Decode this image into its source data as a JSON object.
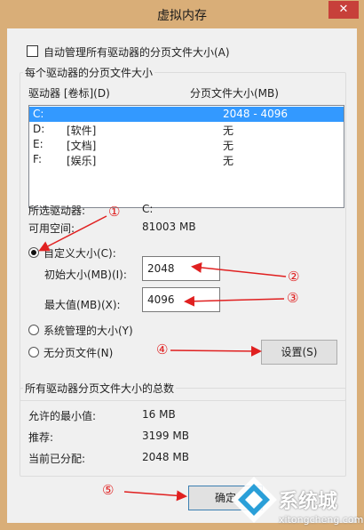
{
  "window": {
    "title": "虚拟内存",
    "close_glyph": "✕"
  },
  "auto_manage": {
    "label": "自动管理所有驱动器的分页文件大小(A)",
    "checked": false
  },
  "paging_group": {
    "title": "每个驱动器的分页文件大小",
    "col_drive": "驱动器 [卷标](D)",
    "col_size": "分页文件大小(MB)",
    "drives": [
      {
        "drive": "C:",
        "label": "",
        "size": "2048 - 4096",
        "selected": true
      },
      {
        "drive": "D:",
        "label": "[软件]",
        "size": "无",
        "selected": false
      },
      {
        "drive": "E:",
        "label": "[文档]",
        "size": "无",
        "selected": false
      },
      {
        "drive": "F:",
        "label": "[娱乐]",
        "size": "无",
        "selected": false
      }
    ],
    "selected_drive_label": "所选驱动器:",
    "selected_drive_value": "C:",
    "free_space_label": "可用空间:",
    "free_space_value": "81003 MB",
    "custom_size": "自定义大小(C):",
    "initial_size_label": "初始大小(MB)(I):",
    "initial_size_value": "2048",
    "max_size_label": "最大值(MB)(X):",
    "max_size_value": "4096",
    "system_managed": "系统管理的大小(Y)",
    "no_paging": "无分页文件(N)",
    "set_button": "设置(S)"
  },
  "totals_group": {
    "title": "所有驱动器分页文件大小的总数",
    "min_label": "允许的最小值:",
    "min_value": "16 MB",
    "recommended_label": "推荐:",
    "recommended_value": "3199 MB",
    "current_label": "当前已分配:",
    "current_value": "2048 MB"
  },
  "ok_button": "确定",
  "annotations": [
    "①",
    "②",
    "③",
    "④",
    "⑤"
  ],
  "watermark": {
    "text": "系统城",
    "url": "xitongcheng.com"
  },
  "colors": {
    "frame": "#d9ae78",
    "selection": "#3399ff",
    "annotation": "#e02020",
    "close": "#c7403a"
  }
}
